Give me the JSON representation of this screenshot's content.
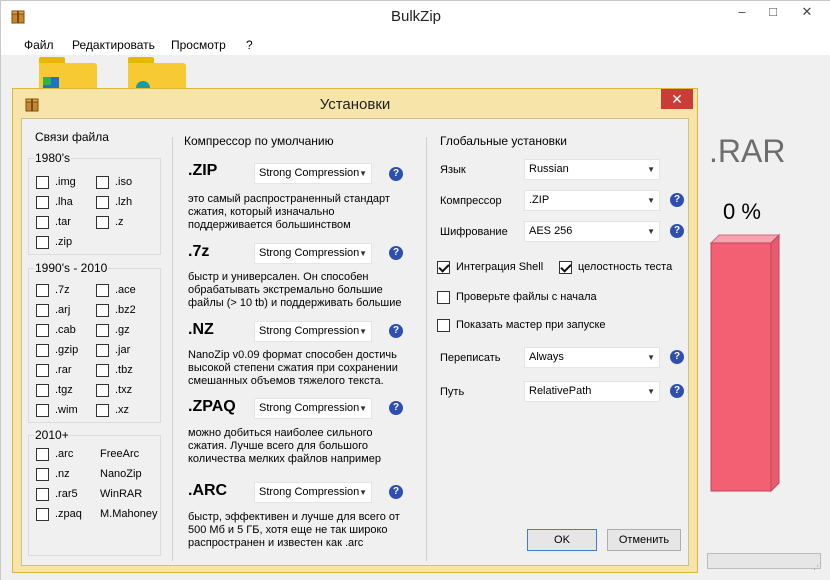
{
  "app": {
    "title": "BulkZip",
    "controls": {
      "minimize": "–",
      "maximize": "□",
      "close": "✕"
    },
    "menu": [
      "Файл",
      "Редактировать",
      "Просмотр",
      "?"
    ],
    "format_display": ".RAR",
    "progress_text": "0 %",
    "progress_value": 0
  },
  "dialog": {
    "title": "Установки",
    "close": "✕",
    "file_assoc": {
      "title": "Связи файла",
      "groups": [
        {
          "label": "1980's",
          "items": [
            {
              "label": ".img",
              "checked": false
            },
            {
              "label": ".iso",
              "checked": false
            },
            {
              "label": ".lha",
              "checked": false
            },
            {
              "label": ".lzh",
              "checked": false
            },
            {
              "label": ".tar",
              "checked": false
            },
            {
              "label": ".z",
              "checked": false
            },
            {
              "label": ".zip",
              "checked": false
            }
          ]
        },
        {
          "label": "1990's - 2010",
          "items": [
            {
              "label": ".7z",
              "checked": false
            },
            {
              "label": ".ace",
              "checked": false
            },
            {
              "label": ".arj",
              "checked": false
            },
            {
              "label": ".bz2",
              "checked": false
            },
            {
              "label": ".cab",
              "checked": false
            },
            {
              "label": ".gz",
              "checked": false
            },
            {
              "label": ".gzip",
              "checked": false
            },
            {
              "label": ".jar",
              "checked": false
            },
            {
              "label": ".rar",
              "checked": false
            },
            {
              "label": ".tbz",
              "checked": false
            },
            {
              "label": ".tgz",
              "checked": false
            },
            {
              "label": ".txz",
              "checked": false
            },
            {
              "label": ".wim",
              "checked": false
            },
            {
              "label": ".xz",
              "checked": false
            }
          ]
        },
        {
          "label": "2010+",
          "items": [
            {
              "label": ".arc",
              "checked": false,
              "app": "FreeArc"
            },
            {
              "label": ".nz",
              "checked": false,
              "app": "NanoZip"
            },
            {
              "label": ".rar5",
              "checked": false,
              "app": "WinRAR"
            },
            {
              "label": ".zpaq",
              "checked": false,
              "app": "M.Mahoney"
            }
          ]
        }
      ]
    },
    "compressors": {
      "title": "Компрессор по умолчанию",
      "items": [
        {
          "name": ".ZIP",
          "selected": "Strong Compression",
          "help": "?",
          "desc": [
            "это самый распространенный стандарт",
            "сжатия, который изначально",
            "поддерживается большинством"
          ]
        },
        {
          "name": ".7z",
          "selected": "Strong Compression",
          "help": "?",
          "desc": [
            "быстр и универсален. Он способен",
            "обрабатывать экстремально большие",
            "файлы (> 10 tb) и поддерживать большие"
          ]
        },
        {
          "name": ".NZ",
          "selected": "Strong Compression",
          "help": "?",
          "desc": [
            "NanoZip v0.09 формат способен достичь",
            "высокой степени сжатия при сохранении",
            "смешанных объемов тяжелого текста."
          ]
        },
        {
          "name": ".ZPAQ",
          "selected": "Strong Compression",
          "help": "?",
          "desc": [
            "можно добиться наиболее сильного",
            "сжатия. Лучше всего для большого",
            "количества мелких файлов например"
          ]
        },
        {
          "name": ".ARC",
          "selected": "Strong Compression",
          "help": "?",
          "desc": [
            "быстр, эффективен и лучше для всего от",
            "500 Мб и 5 ГБ, хотя еще не так широко",
            "распространен и известен как .arc"
          ]
        }
      ]
    },
    "global": {
      "title": "Глобальные установки",
      "language": {
        "label": "Язык",
        "value": "Russian"
      },
      "compressor": {
        "label": "Компрессор",
        "value": ".ZIP",
        "help": "?"
      },
      "encryption": {
        "label": "Шифрование",
        "value": "AES 256",
        "help": "?"
      },
      "shell": {
        "label": "Интеграция Shell",
        "checked": true
      },
      "integrity": {
        "label": "целостность теста",
        "checked": true
      },
      "check_files": {
        "label": "Проверьте файлы с начала",
        "checked": false
      },
      "wizard": {
        "label": "Показать мастер при запуске",
        "checked": false
      },
      "overwrite": {
        "label": "Переписать",
        "value": "Always",
        "help": "?"
      },
      "path": {
        "label": "Путь",
        "value": "RelativePath",
        "help": "?"
      }
    },
    "buttons": {
      "ok": "OK",
      "cancel": "Отменить"
    }
  }
}
